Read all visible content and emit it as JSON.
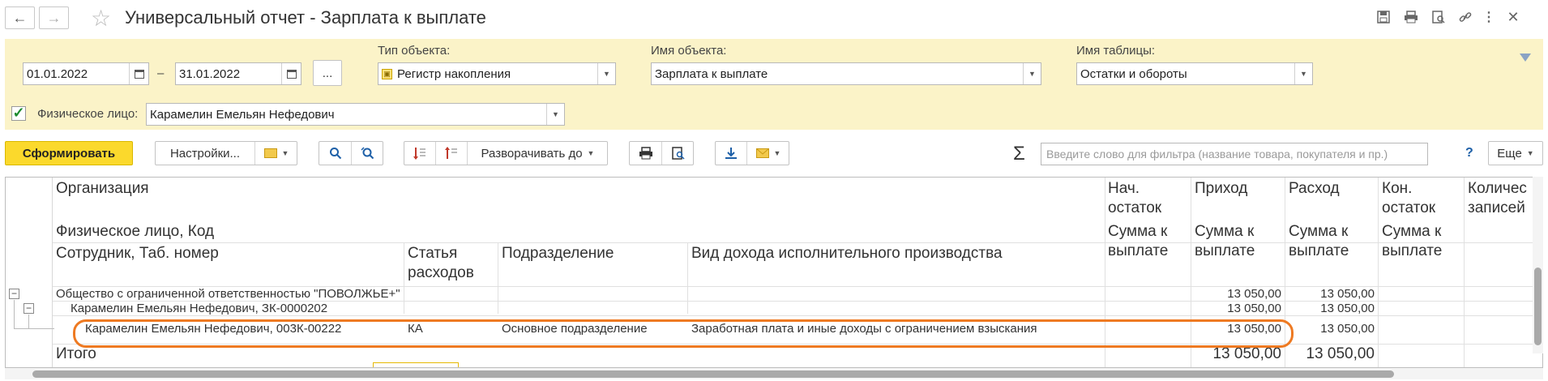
{
  "window": {
    "title": "Универсальный отчет - Зарплата к выплате"
  },
  "filters": {
    "date_from": "01.01.2022",
    "date_sep": "–",
    "date_to": "31.01.2022",
    "more_button": "...",
    "object_type_label": "Тип объекта:",
    "object_type_value": "Регистр накопления",
    "object_name_label": "Имя объекта:",
    "object_name_value": "Зарплата к выплате",
    "table_name_label": "Имя таблицы:",
    "table_name_value": "Остатки и обороты",
    "person_label": "Физическое лицо:",
    "person_value": "Карамелин Емельян Нефедович",
    "person_checked": true
  },
  "toolbar": {
    "generate": "Сформировать",
    "settings": "Настройки...",
    "expand_to": "Разворачивать до",
    "search_placeholder": "Введите слово для фильтра (название товара, покупателя и пр.)",
    "help": "?",
    "more": "Еще"
  },
  "report": {
    "headers": {
      "organization": "Организация",
      "person_code": "Физическое лицо, Код",
      "employee": "Сотрудник, Таб. номер",
      "expense_item_1": "Статья",
      "expense_item_2": "расходов",
      "department": "Подразделение",
      "income_type": "Вид дохода исполнительного производства",
      "start_balance_1": "Нач.",
      "start_balance_2": "остаток",
      "income": "Приход",
      "expense": "Расход",
      "end_balance_1": "Кон.",
      "end_balance_2": "остаток",
      "count_1": "Количес",
      "count_2": "записей",
      "sum_1": "Сумма к",
      "sum_2": "выплате"
    },
    "rows": [
      {
        "label": "Общество с ограниченной ответственностью \"ПОВОЛЖЬЕ+\"",
        "income": "13 050,00",
        "expense": "13 050,00"
      },
      {
        "label": "Карамелин Емельян Нефедович, ЗК-0000202",
        "income": "13 050,00",
        "expense": "13 050,00"
      },
      {
        "label": "Карамелин Емельян Нефедович, 003К-00222",
        "expense_item": "КА",
        "department": "Основное подразделение",
        "income_type": "Заработная плата и иные доходы с ограничением взыскания",
        "income": "13 050,00",
        "expense": "13 050,00"
      }
    ],
    "total": {
      "label": "Итого",
      "income": "13 050,00",
      "expense": "13 050,00"
    }
  }
}
